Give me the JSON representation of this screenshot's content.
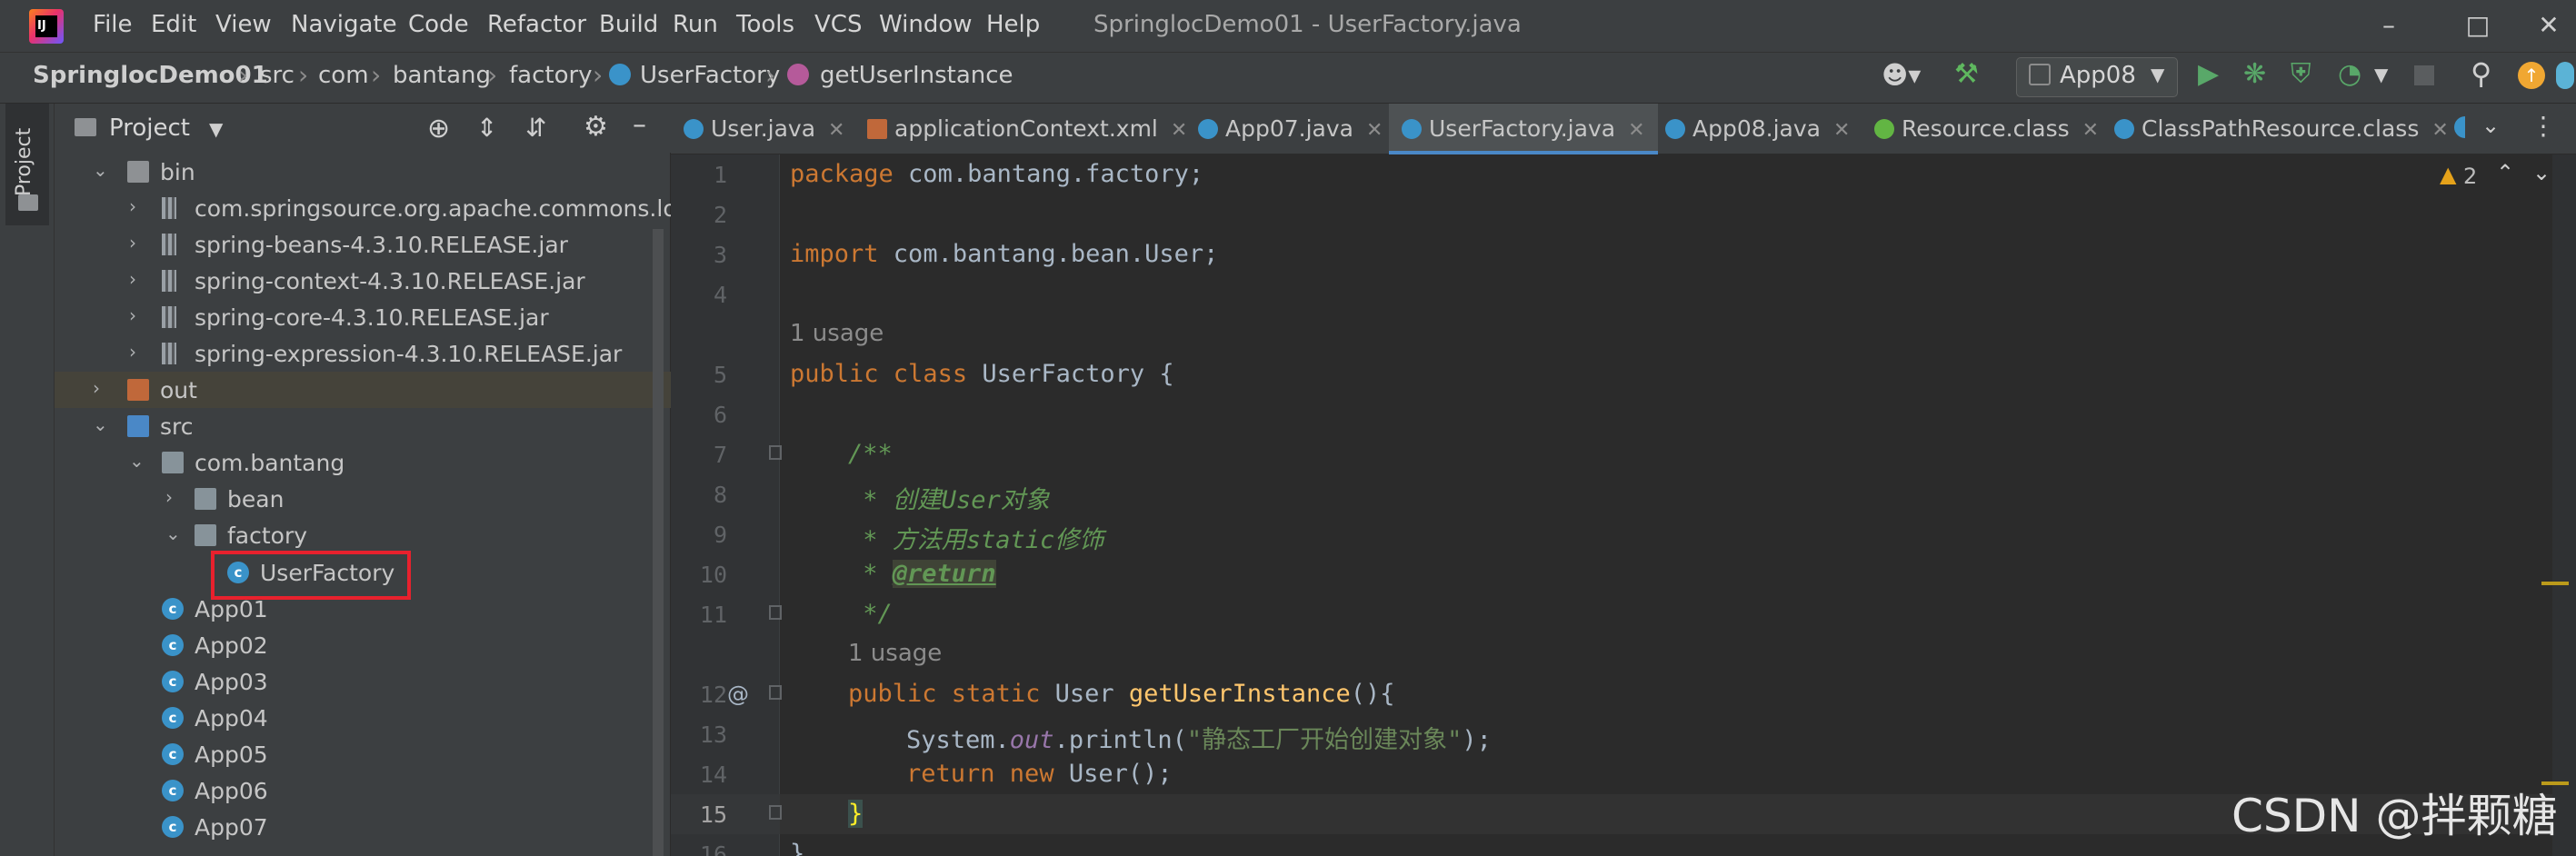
{
  "app": {
    "window_title": "SpringlocDemo01 - UserFactory.java"
  },
  "menu": [
    "File",
    "Edit",
    "View",
    "Navigate",
    "Code",
    "Refactor",
    "Build",
    "Run",
    "Tools",
    "VCS",
    "Window",
    "Help"
  ],
  "breadcrumb": {
    "project": "SpringlocDemo01",
    "p1": "src",
    "p2": "com",
    "p3": "bantang",
    "p4": "factory",
    "cls": "UserFactory",
    "method": "getUserInstance"
  },
  "run_config": "App08",
  "project_panel": {
    "title": "Project"
  },
  "tree": [
    {
      "label": "bin",
      "icon": "folder-icon"
    },
    {
      "label": "com.springsource.org.apache.commons.logging",
      "icon": "jar-icon"
    },
    {
      "label": "spring-beans-4.3.10.RELEASE.jar",
      "icon": "jar-icon"
    },
    {
      "label": "spring-context-4.3.10.RELEASE.jar",
      "icon": "jar-icon"
    },
    {
      "label": "spring-core-4.3.10.RELEASE.jar",
      "icon": "jar-icon"
    },
    {
      "label": "spring-expression-4.3.10.RELEASE.jar",
      "icon": "jar-icon"
    },
    {
      "label": "out",
      "icon": "folder-icon"
    },
    {
      "label": "src",
      "icon": "folder-icon"
    },
    {
      "label": "com.bantang",
      "icon": "package-icon"
    },
    {
      "label": "bean",
      "icon": "package-icon"
    },
    {
      "label": "factory",
      "icon": "package-icon"
    },
    {
      "label": "UserFactory",
      "icon": "class-icon"
    },
    {
      "label": "App01",
      "icon": "class-icon"
    },
    {
      "label": "App02",
      "icon": "class-icon"
    },
    {
      "label": "App03",
      "icon": "class-icon"
    },
    {
      "label": "App04",
      "icon": "class-icon"
    },
    {
      "label": "App05",
      "icon": "class-icon"
    },
    {
      "label": "App06",
      "icon": "class-icon"
    },
    {
      "label": "App07",
      "icon": "class-icon"
    }
  ],
  "tabs": [
    "User.java",
    "applicationContext.xml",
    "App07.java",
    "UserFactory.java",
    "App08.java",
    "Resource.class",
    "ClassPathResource.class"
  ],
  "active_tab": "UserFactory.java",
  "editor": {
    "warnings": "2",
    "line_numbers": [
      "1",
      "2",
      "3",
      "4",
      "5",
      "6",
      "7",
      "8",
      "9",
      "10",
      "11",
      "12",
      "13",
      "14",
      "15",
      "16"
    ],
    "usage_hint": "1 usage",
    "code": {
      "pkg_kw": "package",
      "pkg_name": " com.bantang.factory;",
      "imp_kw": "import",
      "imp_name": " com.bantang.bean.User;",
      "cls_kw1": "public",
      "cls_kw2": " class",
      "cls_rest": " UserFactory {",
      "doc_open": "/**",
      "doc_l1": " * 创建User对象",
      "doc_l2": " * 方法用static修饰",
      "doc_star": " * ",
      "doc_tag": "@return",
      "doc_close": " */",
      "m_kw1": "public",
      "m_kw2": " static",
      "m_type": " User ",
      "m_name": "getUserInstance",
      "m_rest": "(){",
      "s_obj": "System.",
      "s_out": "out",
      "s_call": ".println(",
      "s_str": "\"静态工厂开始创建对象\"",
      "s_end": ");",
      "r_kw1": "return",
      "r_kw2": " new",
      "r_rest": " User();",
      "close_brace": "}",
      "last_brace": "}"
    }
  },
  "watermark": "CSDN @拌颗糖"
}
